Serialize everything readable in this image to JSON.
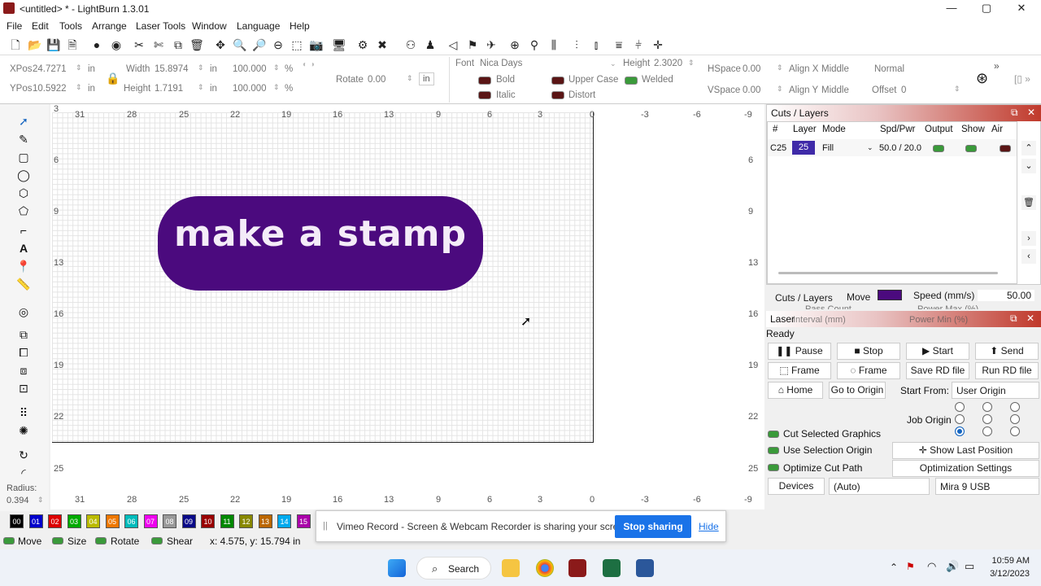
{
  "window": {
    "title": "<untitled> * - LightBurn 1.3.01",
    "minimize": "—",
    "maximize": "▢",
    "close": "✕"
  },
  "menu": [
    "File",
    "Edit",
    "Tools",
    "Arrange",
    "Laser Tools",
    "Window",
    "Language",
    "Help"
  ],
  "props": {
    "xpos_label": "XPos",
    "xpos_value": "24.7271",
    "ypos_label": "YPos",
    "ypos_value": "10.5922",
    "unit_in": "in",
    "width_label": "Width",
    "width_value": "15.8974",
    "height_label": "Height",
    "height_value": "1.7191",
    "pct1": "100.000",
    "pct2": "100.000",
    "pct_sign": "%",
    "rotate_label": "Rotate",
    "rotate_value": "0.00",
    "rotate_unit": "in",
    "font_label": "Font",
    "font_value": "Nica Days",
    "text_height_label": "Height",
    "text_height_value": "2.3020",
    "bold": "Bold",
    "italic": "Italic",
    "upper_case": "Upper Case",
    "distort": "Distort",
    "welded": "Welded",
    "hspace_label": "HSpace",
    "hspace_value": "0.00",
    "vspace_label": "VSpace",
    "vspace_value": "0.00",
    "alignx_label": "Align X",
    "alignx_value": "Middle",
    "aligny_label": "Align Y",
    "aligny_value": "Middle",
    "normal": "Normal",
    "offset_label": "Offset",
    "offset_value": "0"
  },
  "rulers": {
    "top": [
      "31",
      "28",
      "25",
      "22",
      "19",
      "16",
      "13",
      "9",
      "6",
      "3",
      "0",
      "-3",
      "-6",
      "-9"
    ],
    "left": [
      "3",
      "6",
      "9",
      "13",
      "16",
      "19",
      "22",
      "25"
    ],
    "right": [
      "6",
      "9",
      "13",
      "16",
      "19",
      "22",
      "25"
    ]
  },
  "radius": {
    "label": "Radius:",
    "value": "0.394"
  },
  "canvas": {
    "stamp_text": "make a stamp",
    "stamp_color": "#4b0a7e"
  },
  "cuts": {
    "header": "Cuts / Layers",
    "columns": [
      "#",
      "Layer",
      "Mode",
      "Spd/Pwr",
      "Output",
      "Show",
      "Air"
    ],
    "row": {
      "id": "C25",
      "layer": "25",
      "mode": "Fill",
      "spd_pwr": "50.0 / 20.0"
    }
  },
  "tabs": {
    "cuts_layers": "Cuts / Layers",
    "move": "Move",
    "speed_label": "Speed (mm/s)",
    "speed_value": "50.00",
    "pass_count_label": "Pass Count",
    "power_max_label": "Power Max (%)",
    "interval_label": "Interval (mm)",
    "power_min_label": "Power Min (%)"
  },
  "laser": {
    "header": "Laser",
    "status": "Ready",
    "pause": "Pause",
    "stop": "Stop",
    "start": "Start",
    "send": "Send",
    "frame1": "Frame",
    "frame2": "Frame",
    "save_rd": "Save RD file",
    "run_rd": "Run RD file",
    "home": "Home",
    "go_origin": "Go to Origin",
    "start_from_label": "Start From:",
    "start_from_value": "User Origin",
    "job_origin_label": "Job Origin",
    "cut_selected": "Cut Selected Graphics",
    "use_selection": "Use Selection Origin",
    "optimize": "Optimize Cut Path",
    "show_last": "Show Last Position",
    "opt_settings": "Optimization Settings",
    "devices": "Devices",
    "devices_value": "(Auto)",
    "device_name": "Mira 9 USB"
  },
  "palette": [
    {
      "label": "00",
      "color": "#000000"
    },
    {
      "label": "01",
      "color": "#0000cc"
    },
    {
      "label": "02",
      "color": "#dd0000"
    },
    {
      "label": "03",
      "color": "#00aa00"
    },
    {
      "label": "04",
      "color": "#bbbb00"
    },
    {
      "label": "05",
      "color": "#ee7700"
    },
    {
      "label": "06",
      "color": "#00bbbb"
    },
    {
      "label": "07",
      "color": "#ee00ee"
    },
    {
      "label": "08",
      "color": "#999999"
    },
    {
      "label": "09",
      "color": "#0a0a88"
    },
    {
      "label": "10",
      "color": "#990000"
    },
    {
      "label": "11",
      "color": "#008800"
    },
    {
      "label": "12",
      "color": "#888800"
    },
    {
      "label": "13",
      "color": "#bb6600"
    },
    {
      "label": "14",
      "color": "#00aaee"
    },
    {
      "label": "15",
      "color": "#aa00aa"
    }
  ],
  "status": {
    "move": "Move",
    "size": "Size",
    "rotate": "Rotate",
    "shear": "Shear",
    "coords": "x: 4.575, y: 15.794 in"
  },
  "notification": {
    "text": "Vimeo Record - Screen & Webcam Recorder is sharing your screen.",
    "stop": "Stop sharing",
    "hide": "Hide"
  },
  "taskbar": {
    "search": "Search",
    "time": "10:59 AM",
    "date": "3/12/2023"
  }
}
